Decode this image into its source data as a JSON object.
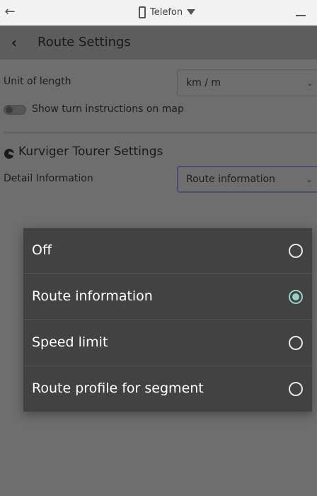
{
  "device_bar": {
    "device_label": "Telefon",
    "icons": {
      "back": "arrow-left-icon",
      "device": "phone-icon",
      "dropdown": "caret-down-icon",
      "minimize": "minimize-icon"
    }
  },
  "header": {
    "title": "Route Settings",
    "back_icon": "chevron-left-icon"
  },
  "settings": {
    "unit_of_length": {
      "label": "Unit of length",
      "value": "km / m"
    },
    "turn_instructions": {
      "label": "Show turn instructions on map",
      "enabled": false
    },
    "section": {
      "title": "Kurviger Tourer Settings",
      "logo_icon": "kurviger-logo-icon"
    },
    "detail_information": {
      "label": "Detail Information",
      "value": "Route information"
    }
  },
  "dialog": {
    "options": [
      {
        "label": "Off",
        "selected": false
      },
      {
        "label": "Route information",
        "selected": true
      },
      {
        "label": "Speed limit",
        "selected": false
      },
      {
        "label": "Route profile for segment",
        "selected": false
      }
    ]
  },
  "colors": {
    "accent_radio": "#8fd3c4",
    "dialog_bg": "#424242",
    "scrim_bg": "#6e6e6e"
  }
}
